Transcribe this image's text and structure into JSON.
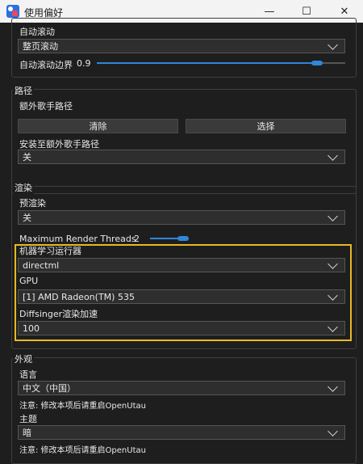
{
  "window": {
    "title": "使用偏好",
    "minimize": "—",
    "maximize": "☐",
    "close": "✕"
  },
  "scroll": {
    "label": "自动滚动",
    "mode_value": "整页滚动",
    "margin_label": "自动滚动边界",
    "margin_value": "0.9"
  },
  "paths": {
    "title": "路径",
    "singer_path_label": "额外歌手路径",
    "clear_button": "清除",
    "select_button": "选择",
    "install_label": "安装至额外歌手路径",
    "install_value": "关"
  },
  "render": {
    "title": "渲染",
    "prerender_label": "预渲染",
    "prerender_value": "关",
    "threads_label": "Maximum Render Threads",
    "threads_value": "2",
    "ml_runner_label": "机器学习运行器",
    "ml_runner_value": "directml",
    "gpu_label": "GPU",
    "gpu_value": "[1] AMD Radeon(TM) 535",
    "diffsinger_label": "Diffsinger渲染加速",
    "diffsinger_value": "100"
  },
  "appearance": {
    "title": "外观",
    "language_label": "语言",
    "language_value": "中文（中国）",
    "language_note": "注意: 修改本项后请重启OpenUtau",
    "theme_label": "主题",
    "theme_value": "暗",
    "theme_note": "注意: 修改本项后请重启OpenUtau"
  },
  "colors": {
    "accent": "#2f87d8",
    "highlight": "#e8b923"
  },
  "sliders": {
    "auto_scroll_margin_fraction": 0.9,
    "render_threads_fraction": 0.25
  }
}
